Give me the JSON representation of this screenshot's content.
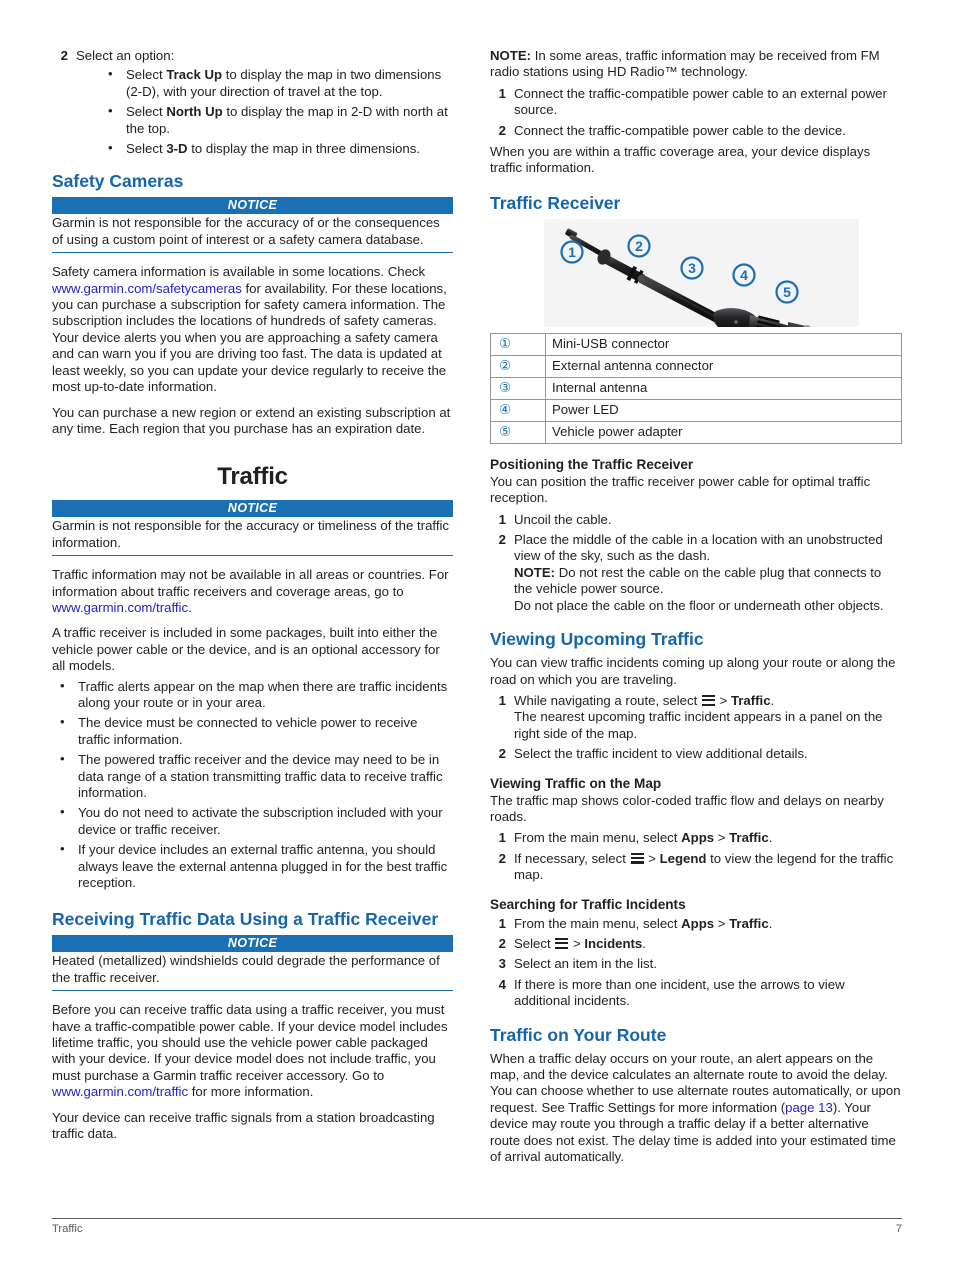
{
  "colors": {
    "heading_blue": "#1465ab",
    "notice_blue": "#1a6fb5",
    "link_blue": "#2222cc",
    "body_text": "#231f20",
    "footer_text": "#58595b",
    "figure_bg": "#f4f4f4"
  },
  "left_column": {
    "step2": {
      "num": "2",
      "text": "Select an option:",
      "bullets": [
        {
          "pre": "Select ",
          "bold": "Track Up",
          "post": " to display the map in two dimensions (2-D), with your direction of travel at the top."
        },
        {
          "pre": "Select ",
          "bold": "North Up",
          "post": " to display the map in 2-D with north at the top."
        },
        {
          "pre": "Select ",
          "bold": "3-D",
          "post": " to display the map in three dimensions."
        }
      ]
    },
    "safety_cameras": {
      "heading": "Safety Cameras",
      "notice_label": "NOTICE",
      "notice_body": "Garmin is not responsible for the accuracy of or the consequences of using a custom point of interest or a safety camera database.",
      "para1_pre": "Safety camera information is available in some locations. Check ",
      "para1_link": "www.garmin.com/safetycameras",
      "para1_post": " for availability. For these locations, you can purchase a subscription for safety camera information. The subscription includes the locations of hundreds of safety cameras. Your device alerts you when you are approaching a safety camera and can warn you if you are driving too fast. The data is updated at least weekly, so you can update your device regularly to receive the most up-to-date information.",
      "para2": "You can purchase a new region or extend an existing subscription at any time. Each region that you purchase has an expiration date."
    },
    "traffic_chapter": {
      "title": "Traffic",
      "notice_label": "NOTICE",
      "notice_body": "Garmin is not responsible for the accuracy or timeliness of the traffic information.",
      "para1_pre": "Traffic information may not be available in all areas or countries. For information about traffic receivers and coverage areas, go to ",
      "para1_link": "www.garmin.com/traffic",
      "para1_post": ".",
      "para2": "A traffic receiver is included in some packages, built into either the vehicle power cable or the device, and is an optional accessory for all models.",
      "bullets": [
        "Traffic alerts appear on the map when there are traffic incidents along your route or in your area.",
        "The device must be connected to vehicle power to receive traffic information.",
        "The powered traffic receiver and the device may need to be in data range of a station transmitting traffic data to receive traffic information.",
        "You do not need to activate the subscription included with your device or traffic receiver.",
        "If your device includes an external traffic antenna, you should always leave the external antenna plugged in for the best traffic reception."
      ]
    },
    "receiving_traffic_data": {
      "heading": "Receiving Traffic Data Using a Traffic Receiver",
      "notice_label": "NOTICE",
      "notice_body": "Heated (metallized) windshields could degrade the performance of the traffic receiver.",
      "para1_pre": "Before you can receive traffic data using a traffic receiver, you must have a traffic-compatible power cable. If your device model includes lifetime traffic, you should use the vehicle power cable packaged with your device. If your device model does not include traffic, you must purchase a Garmin traffic receiver accessory. Go to ",
      "para1_link": "www.garmin.com/traffic",
      "para1_post": " for more information.",
      "para2": "Your device can receive traffic signals from a station broadcasting traffic data."
    }
  },
  "right_column": {
    "note_top": {
      "label": "NOTE:",
      "text": " In some areas, traffic information may be received from FM radio stations using HD Radio™ technology."
    },
    "steps_top": [
      {
        "num": "1",
        "text": "Connect the traffic-compatible power cable to an external power source."
      },
      {
        "num": "2",
        "text": "Connect the traffic-compatible power cable to the device."
      }
    ],
    "para_after_steps": "When you are within a traffic coverage area, your device displays traffic information.",
    "traffic_receiver": {
      "heading": "Traffic Receiver",
      "figure_alt": "traffic receiver power cable with callouts",
      "callout_labels": [
        "1",
        "2",
        "3",
        "4",
        "5"
      ],
      "table": [
        {
          "idx": "①",
          "label": "Mini-USB connector"
        },
        {
          "idx": "②",
          "label": "External antenna connector"
        },
        {
          "idx": "③",
          "label": "Internal antenna"
        },
        {
          "idx": "④",
          "label": "Power LED"
        },
        {
          "idx": "⑤",
          "label": "Vehicle power adapter"
        }
      ]
    },
    "positioning": {
      "heading": "Positioning the Traffic Receiver",
      "intro": "You can position the traffic receiver power cable for optimal traffic reception.",
      "step1": {
        "num": "1",
        "text": "Uncoil the cable."
      },
      "step2": {
        "num": "2",
        "text": "Place the middle of the cable in a location with an unobstructed view of the sky, such as the dash.",
        "note_label": "NOTE:",
        "note_text": " Do not rest the cable on the cable plug that connects to the vehicle power source.",
        "extra": "Do not place the cable on the floor or underneath other objects."
      }
    },
    "viewing_upcoming": {
      "heading": "Viewing Upcoming Traffic",
      "intro": "You can view traffic incidents coming up along your route or along the road on which you are traveling.",
      "step1": {
        "num": "1",
        "pre": "While navigating a route, select ",
        "mid": " > ",
        "bold": "Traffic",
        "post": ".",
        "sub": "The nearest upcoming traffic incident appears in a panel on the right side of the map."
      },
      "step2": {
        "num": "2",
        "text": "Select the traffic incident to view additional details."
      }
    },
    "viewing_map": {
      "heading": "Viewing Traffic on the Map",
      "intro": "The traffic map shows color-coded traffic flow and delays on nearby roads.",
      "step1": {
        "num": "1",
        "pre": "From the main menu, select ",
        "bold1": "Apps",
        "mid": " > ",
        "bold2": "Traffic",
        "post": "."
      },
      "step2": {
        "num": "2",
        "pre": "If necessary, select ",
        "mid": " > ",
        "bold": "Legend",
        "post": " to view the legend for the traffic map."
      }
    },
    "searching": {
      "heading": "Searching for Traffic Incidents",
      "step1": {
        "num": "1",
        "pre": "From the main menu, select ",
        "bold1": "Apps",
        "mid": " > ",
        "bold2": "Traffic",
        "post": "."
      },
      "step2": {
        "num": "2",
        "pre": "Select ",
        "mid": " > ",
        "bold": "Incidents",
        "post": "."
      },
      "step3": {
        "num": "3",
        "text": "Select an item in the list."
      },
      "step4": {
        "num": "4",
        "text": "If there is more than one incident, use the arrows to view additional incidents."
      }
    },
    "traffic_on_route": {
      "heading": "Traffic on Your Route",
      "pre": "When a traffic delay occurs on your route, an alert appears on the map, and the device calculates an alternate route to avoid the delay. You can choose whether to use alternate routes automatically, or upon request. See Traffic Settings for more information (",
      "link": "page 13",
      "post": "). Your device may route you through a traffic delay if a better alternative route does not exist. The delay time is added into your estimated time of arrival automatically."
    }
  },
  "footer": {
    "chapter": "Traffic",
    "page_number": "7"
  }
}
